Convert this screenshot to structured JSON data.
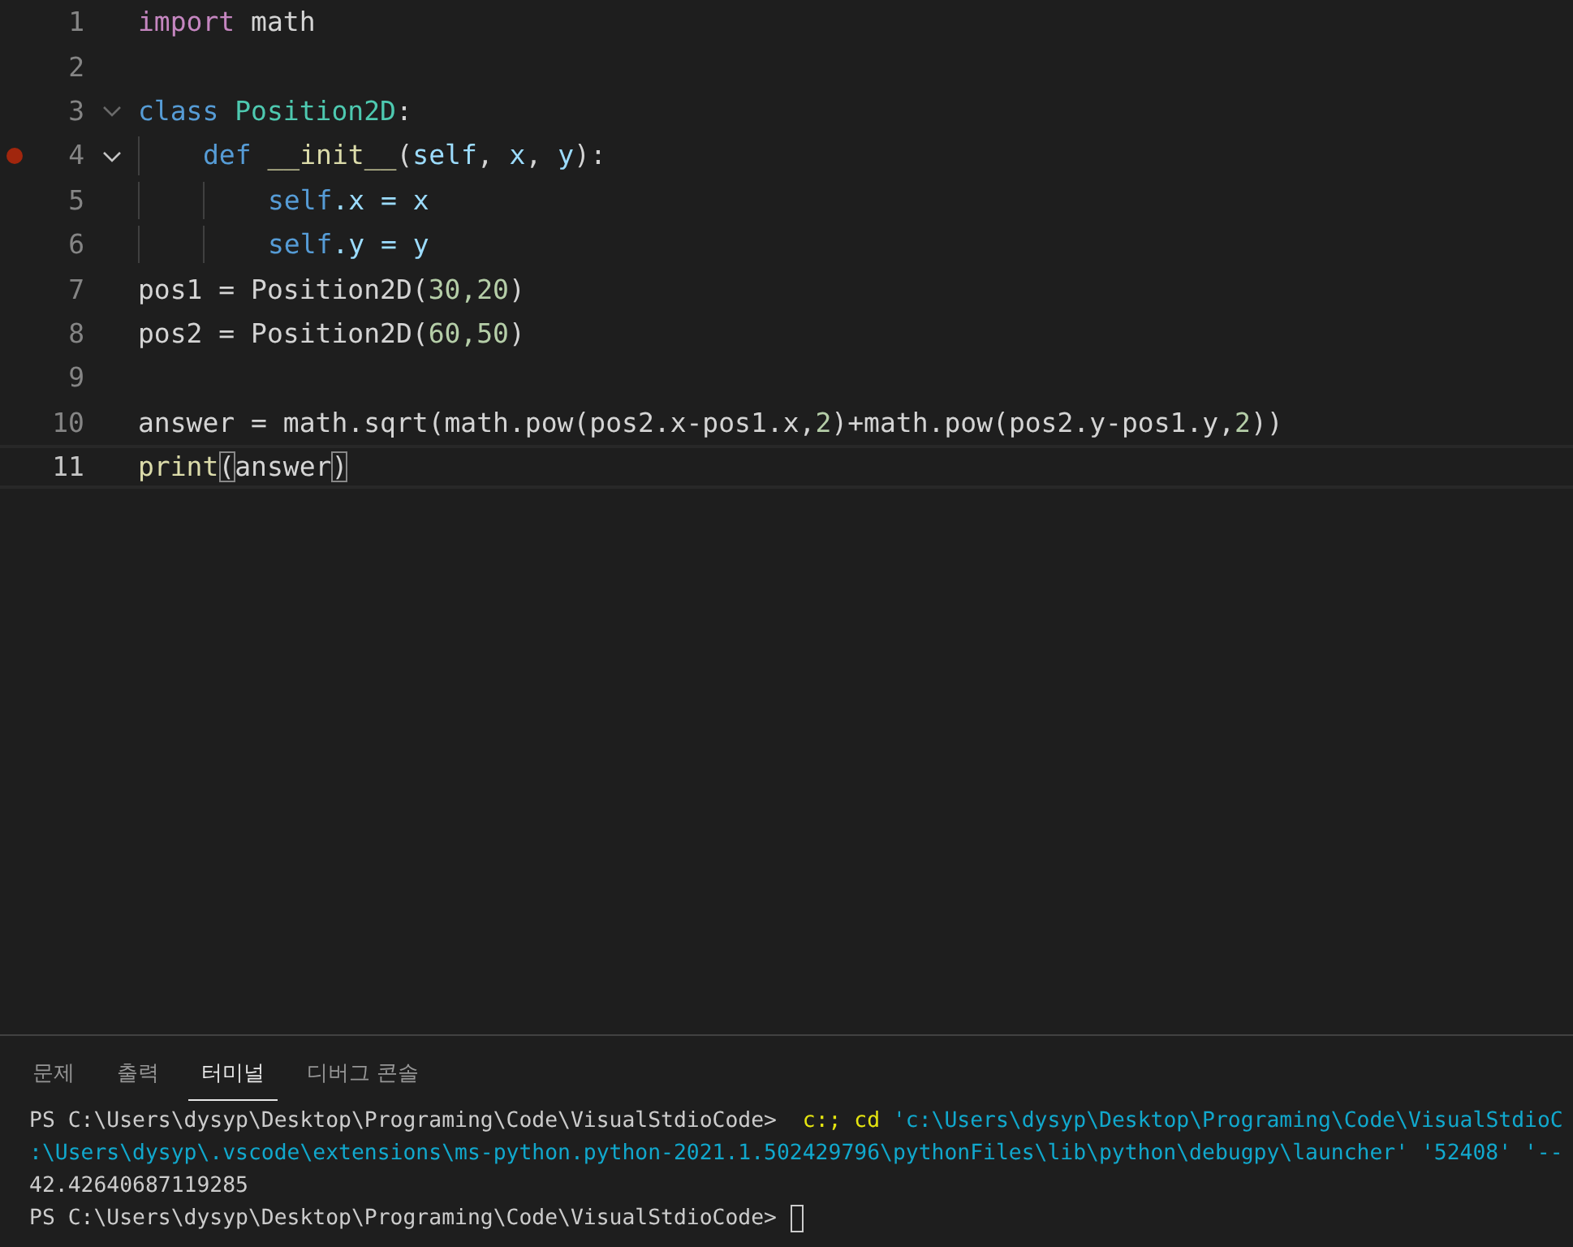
{
  "editor": {
    "lines": [
      {
        "number": "1",
        "breakpoint": false,
        "current": false,
        "tokens": [
          {
            "text": "import",
            "kind": "keyword"
          },
          {
            "text": " math",
            "kind": "plain"
          }
        ]
      },
      {
        "number": "2",
        "breakpoint": false,
        "current": false
      },
      {
        "number": "3",
        "breakpoint": false,
        "current": false,
        "expanded": true,
        "tokens": [
          {
            "text": "class",
            "kind": "storage"
          },
          {
            "text": " Position2D",
            "kind": "type"
          },
          {
            "text": ":",
            "kind": "plain"
          }
        ],
        "children": [
          {
            "number": "4",
            "breakpoint": true,
            "current": false,
            "expanded": true,
            "tokens": [
              {
                "text": "def",
                "kind": "storage"
              },
              {
                "text": " __init__",
                "kind": "function"
              },
              {
                "text": "(",
                "kind": "plain"
              },
              {
                "text": "self",
                "kind": "param"
              },
              {
                "text": ", ",
                "kind": "plain"
              },
              {
                "text": "x",
                "kind": "param"
              },
              {
                "text": ", ",
                "kind": "plain"
              },
              {
                "text": "y",
                "kind": "param"
              },
              {
                "text": "):",
                "kind": "plain"
              }
            ],
            "children": [
              {
                "number": "5",
                "breakpoint": false,
                "current": false,
                "tokens": [
                  {
                    "text": "self",
                    "kind": "storage"
                  },
                  {
                    "text": ".x = x",
                    "kind": "param"
                  }
                ]
              },
              {
                "number": "6",
                "breakpoint": false,
                "current": false,
                "tokens": [
                  {
                    "text": "self",
                    "kind": "storage"
                  },
                  {
                    "text": ".y = y",
                    "kind": "param"
                  }
                ]
              }
            ]
          }
        ]
      },
      {
        "number": "7",
        "breakpoint": false,
        "current": false,
        "tokens": [
          {
            "text": "pos1 = Position2D(",
            "kind": "plain"
          },
          {
            "text": "30,20",
            "kind": "number"
          },
          {
            "text": ")",
            "kind": "plain"
          }
        ]
      },
      {
        "number": "8",
        "breakpoint": false,
        "current": false,
        "tokens": [
          {
            "text": "pos2 = Position2D(",
            "kind": "plain"
          },
          {
            "text": "60,50",
            "kind": "number"
          },
          {
            "text": ")",
            "kind": "plain"
          }
        ]
      },
      {
        "number": "9",
        "breakpoint": false,
        "current": false
      },
      {
        "number": "10",
        "breakpoint": false,
        "current": false,
        "tokens": [
          {
            "text": "answer = math.sqrt(math.pow(pos2.x-pos1.x,",
            "kind": "plain"
          },
          {
            "text": "2",
            "kind": "number"
          },
          {
            "text": ")+math.pow(pos2.y-pos1.y,",
            "kind": "plain"
          },
          {
            "text": "2",
            "kind": "number"
          },
          {
            "text": "))",
            "kind": "plain"
          }
        ]
      },
      {
        "number": "11",
        "breakpoint": false,
        "current": true,
        "tokens": [
          {
            "text": "print",
            "kind": "function"
          },
          {
            "text": "(",
            "kind": "bracket"
          },
          {
            "text": "answer",
            "kind": "plain"
          },
          {
            "text": ")",
            "kind": "bracket"
          }
        ]
      }
    ]
  },
  "panel": {
    "tabs": [
      {
        "label": "문제",
        "selected": false
      },
      {
        "label": "출력",
        "selected": false
      },
      {
        "label": "터미널",
        "selected": true
      },
      {
        "label": "디버그 콘솔",
        "selected": false
      }
    ],
    "terminal": {
      "lines": [
        {
          "segments": [
            {
              "text": "PS C:\\Users\\dysyp\\Desktop\\Programing\\Code\\VisualStdioCode>",
              "kind": "plain"
            },
            {
              "text": "  c:;",
              "kind": "command"
            },
            {
              "text": " cd",
              "kind": "command"
            },
            {
              "text": " 'c:\\Users\\dysyp\\Desktop\\Programing\\Code\\VisualStdioC",
              "kind": "string"
            }
          ]
        },
        {
          "segments": [
            {
              "text": ":\\Users\\dysyp\\.vscode\\extensions\\ms-python.python-2021.1.502429796\\pythonFiles\\lib\\python\\debugpy\\launcher' '52408' '--",
              "kind": "string"
            }
          ]
        },
        {
          "segments": [
            {
              "text": "42.42640687119285",
              "kind": "plain"
            }
          ]
        },
        {
          "segments": [
            {
              "text": "PS C:\\Users\\dysyp\\Desktop\\Programing\\Code\\VisualStdioCode>",
              "kind": "plain"
            }
          ],
          "cursor": true
        }
      ]
    }
  }
}
